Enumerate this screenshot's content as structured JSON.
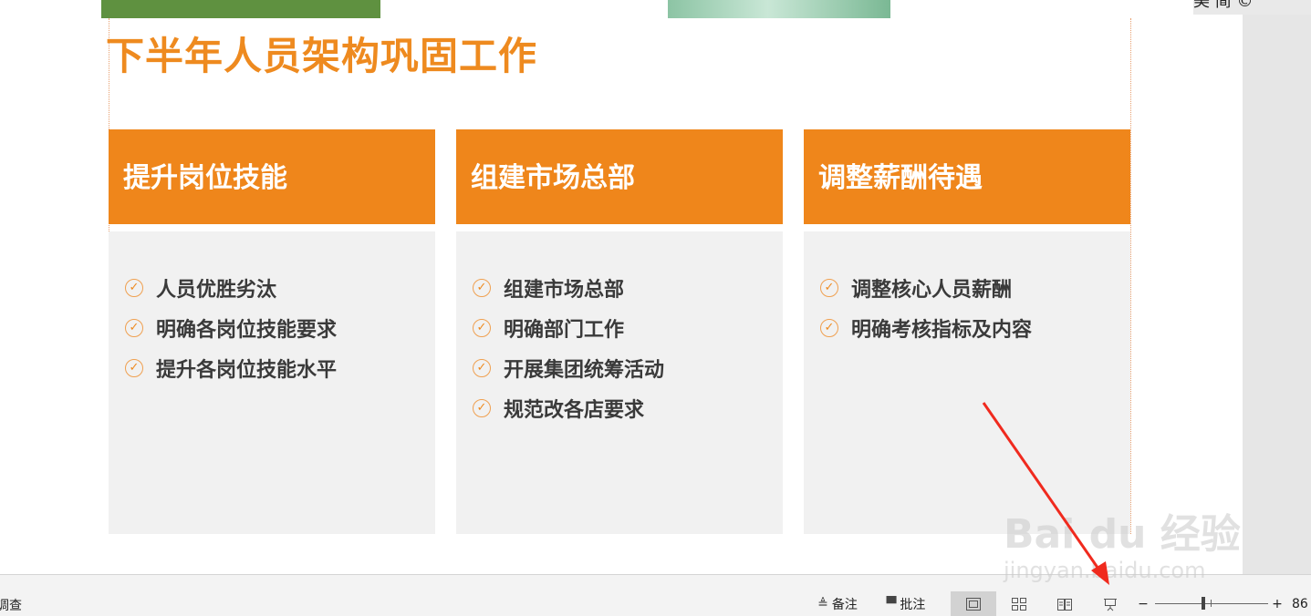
{
  "top_right": {
    "text": "美  简  ©"
  },
  "slide": {
    "title": "下半年人员架构巩固工作",
    "columns": [
      {
        "title": "提升岗位技能",
        "items": [
          "人员优胜劣汰",
          "明确各岗位技能要求",
          "提升各岗位技能水平"
        ]
      },
      {
        "title": "组建市场总部",
        "items": [
          "组建市场总部",
          "明确部门工作",
          "开展集团统筹活动",
          "规范改各店要求"
        ]
      },
      {
        "title": "调整薪酬待遇",
        "items": [
          "调整核心人员薪酬",
          "明确考核指标及内容"
        ]
      }
    ]
  },
  "statusbar": {
    "left_text": "调查",
    "notes_label": "备注",
    "comments_label": "批注",
    "zoom_minus": "−",
    "zoom_plus": "+",
    "zoom_value": "86"
  },
  "watermark": {
    "logo": "Bai du 经验",
    "url": "jingyan.baidu.com"
  },
  "colors": {
    "accent": "#ef861b",
    "title": "#ee8a1f",
    "card_body": "#f1f1f1",
    "arrow": "#f02a1e"
  }
}
